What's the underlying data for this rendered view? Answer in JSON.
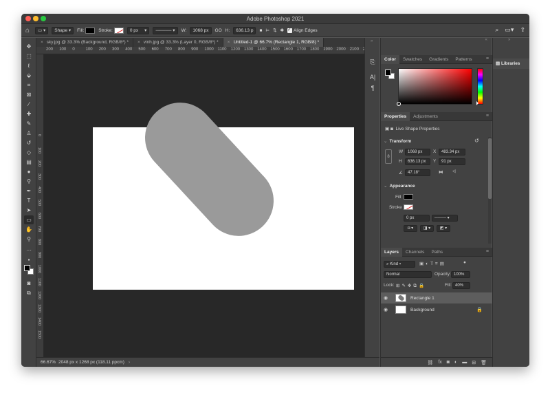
{
  "app": {
    "title": "Adobe Photoshop 2021"
  },
  "options_bar": {
    "home_icon": "home-icon",
    "tool_preset_icon": "rectangle-tool-icon",
    "mode": "Shape",
    "fill_label": "Fill:",
    "fill_color": "#000000",
    "stroke_label": "Stroke:",
    "stroke_width": "0 px",
    "width_label": "W:",
    "width_value": "1068 px",
    "link_label": "GO",
    "height_label": "H:",
    "height_value": "636.13 p",
    "align_edges_label": "Align Edges"
  },
  "tabs": [
    {
      "label": "sky.jpg @ 33.3% (Background, RGB/8*) *",
      "active": false
    },
    {
      "label": "vinh.jpg @ 33.3% (Layer 0, RGB/8*) *",
      "active": false
    },
    {
      "label": "Untitled-1 @ 66.7% (Rectangle 1, RGB/8) *",
      "active": true
    }
  ],
  "ruler_top_labels": [
    "200",
    "100",
    "0",
    "100",
    "200",
    "300",
    "400",
    "500",
    "600",
    "700",
    "800",
    "900",
    "1000",
    "1100",
    "1200",
    "1300",
    "1400",
    "1500",
    "1600",
    "1700",
    "1800",
    "1900",
    "2000",
    "2100",
    "2200"
  ],
  "ruler_left_labels": [
    "0",
    "100",
    "200",
    "300",
    "400",
    "500",
    "600",
    "700",
    "800",
    "900",
    "1000",
    "1100",
    "1200",
    "1300",
    "1400",
    "1500"
  ],
  "status": {
    "zoom": "66.67%",
    "doc_size": "2048 px x 1268 px (118.11 ppcm)"
  },
  "color_panel": {
    "tabs": [
      "Color",
      "Swatches",
      "Gradients",
      "Patterns"
    ],
    "fg_color": "#000000",
    "bg_color": "#ffffff",
    "hue_color": "#ff0000"
  },
  "properties": {
    "tabs": [
      "Properties",
      "Adjustments"
    ],
    "subtitle": "Live Shape Properties",
    "transform_title": "Transform",
    "w_label": "W",
    "w_value": "1068 px",
    "x_label": "X",
    "x_value": "483.34 px",
    "h_label": "H",
    "h_value": "636.13 px",
    "y_label": "Y",
    "y_value": "91 px",
    "angle_value": "47.18°",
    "appearance_title": "Appearance",
    "fill_label": "Fill",
    "stroke_label": "Stroke",
    "stroke_width": "0 px"
  },
  "layers": {
    "tabs": [
      "Layers",
      "Channels",
      "Paths"
    ],
    "kind_label": "Kind",
    "blend_mode": "Normal",
    "opacity_label": "Opacity:",
    "opacity_value": "100%",
    "lock_label": "Lock:",
    "fill_label": "Fill:",
    "fill_value": "40%",
    "items": [
      {
        "name": "Rectangle 1",
        "selected": true
      },
      {
        "name": "Background",
        "selected": false
      }
    ]
  },
  "libraries": {
    "label": "Libraries"
  },
  "canvas": {
    "background": "#ffffff",
    "shape_color": "#9a9a9a",
    "shape_rotation_deg": 47.18
  }
}
